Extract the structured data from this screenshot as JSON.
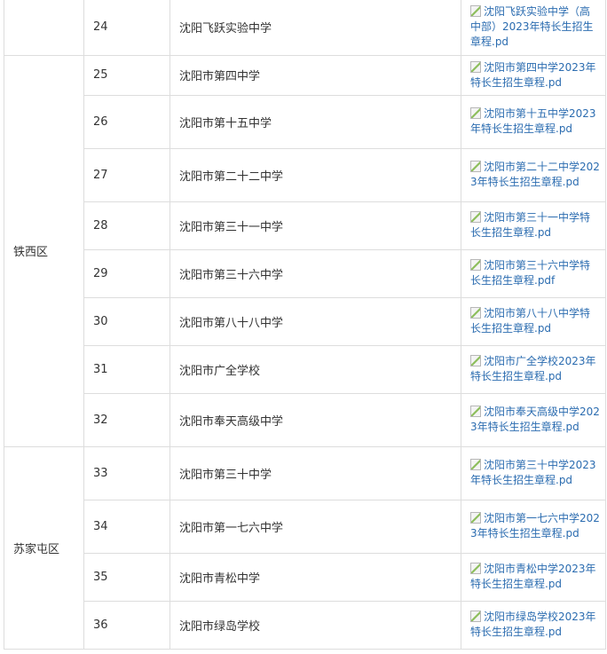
{
  "rows": [
    {
      "district": "",
      "num": "24",
      "name": "沈阳飞跃实验中学",
      "file": "沈阳飞跃实验中学（高中部）2023年特长生招生章程.pd",
      "height": 62
    },
    {
      "district": "铁西区",
      "num": "25",
      "name": "沈阳市第四中学",
      "file": "沈阳市第四中学2023年特长生招生章程.pd",
      "height": 45
    },
    {
      "district": "",
      "num": "26",
      "name": "沈阳市第十五中学",
      "file": "沈阳市第十五中学2023年特长生招生章程.pd",
      "height": 60
    },
    {
      "district": "",
      "num": "27",
      "name": "沈阳市第二十二中学",
      "file": "沈阳市第二十二中学2023年特长生招生章程.pd",
      "height": 60
    },
    {
      "district": "",
      "num": "28",
      "name": "沈阳市第三十一中学",
      "file": "沈阳市第三十一中学特长生招生章程.pd",
      "height": 54
    },
    {
      "district": "",
      "num": "29",
      "name": "沈阳市第三十六中学",
      "file": "沈阳市第三十六中学特长生招生章程.pdf",
      "height": 54
    },
    {
      "district": "",
      "num": "30",
      "name": "沈阳市第八十八中学",
      "file": "沈阳市第八十八中学特长生招生章程.pd",
      "height": 54
    },
    {
      "district": "",
      "num": "31",
      "name": "沈阳市广全学校",
      "file": "沈阳市广全学校2023年特长生招生章程.pd",
      "height": 54
    },
    {
      "district": "",
      "num": "32",
      "name": "沈阳市奉天高级中学",
      "file": "沈阳市奉天高级中学2023年特长生招生章程.pd",
      "height": 60
    },
    {
      "district": "苏家屯区",
      "num": "33",
      "name": "沈阳市第三十中学",
      "file": "沈阳市第三十中学2023年特长生招生章程.pd",
      "height": 60
    },
    {
      "district": "",
      "num": "34",
      "name": "沈阳市第一七六中学",
      "file": "沈阳市第一七六中学2023年特长生招生章程.pd",
      "height": 60
    },
    {
      "district": "",
      "num": "35",
      "name": "沈阳市青松中学",
      "file": "沈阳市青松中学2023年特长生招生章程.pd",
      "height": 54
    },
    {
      "district": "",
      "num": "36",
      "name": "沈阳市绿岛学校",
      "file": "沈阳市绿岛学校2023年特长生招生章程.pd",
      "height": 54
    }
  ],
  "districts": {
    "tiexi": "铁西区",
    "sujiatun": "苏家屯区"
  },
  "colors": {
    "link": "#2b6cb0",
    "text": "#333333",
    "border": "#dddddd"
  }
}
